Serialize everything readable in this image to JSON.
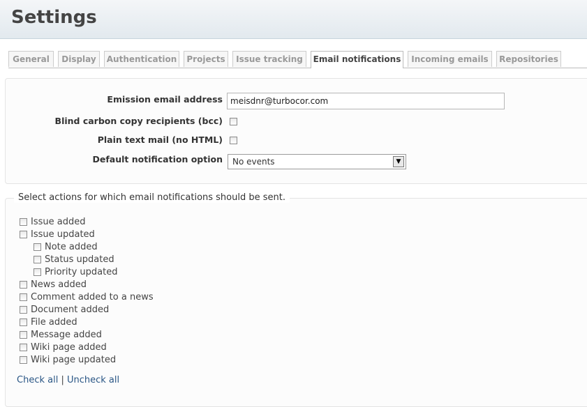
{
  "page_title": "Settings",
  "tabs": [
    {
      "label": "General"
    },
    {
      "label": "Display"
    },
    {
      "label": "Authentication"
    },
    {
      "label": "Projects"
    },
    {
      "label": "Issue tracking"
    },
    {
      "label": "Email notifications"
    },
    {
      "label": "Incoming emails"
    },
    {
      "label": "Repositories"
    }
  ],
  "selected_tab": "Email notifications",
  "form": {
    "emission_label": "Emission email address",
    "emission_value": "meisdnr@turbocor.com",
    "bcc_label": "Blind carbon copy recipients (bcc)",
    "bcc_checked": false,
    "plain_label": "Plain text mail (no HTML)",
    "plain_checked": false,
    "default_label": "Default notification option",
    "default_value": "No events"
  },
  "actions": {
    "legend": "Select actions for which email notifications should be sent.",
    "items": [
      {
        "label": "Issue added",
        "indent": 0,
        "checked": false
      },
      {
        "label": "Issue updated",
        "indent": 0,
        "checked": false
      },
      {
        "label": "Note added",
        "indent": 1,
        "checked": false
      },
      {
        "label": "Status updated",
        "indent": 1,
        "checked": false
      },
      {
        "label": "Priority updated",
        "indent": 1,
        "checked": false
      },
      {
        "label": "News added",
        "indent": 0,
        "checked": false
      },
      {
        "label": "Comment added to a news",
        "indent": 0,
        "checked": false
      },
      {
        "label": "Document added",
        "indent": 0,
        "checked": false
      },
      {
        "label": "File added",
        "indent": 0,
        "checked": false
      },
      {
        "label": "Message added",
        "indent": 0,
        "checked": false
      },
      {
        "label": "Wiki page added",
        "indent": 0,
        "checked": false
      },
      {
        "label": "Wiki page updated",
        "indent": 0,
        "checked": false
      }
    ],
    "check_all": "Check all",
    "separator": "|",
    "uncheck_all": "Uncheck all"
  },
  "icons": {
    "select_arrow": "chevron-down-icon"
  }
}
